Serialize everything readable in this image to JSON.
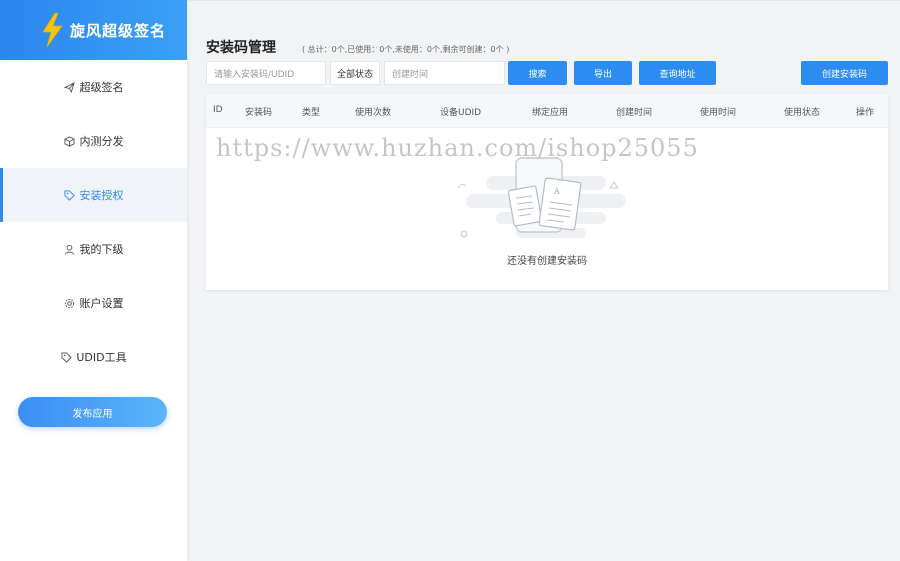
{
  "app": {
    "name": "旋风超级签名"
  },
  "sidebar": {
    "items": [
      {
        "label": "超级签名",
        "icon": "send-icon"
      },
      {
        "label": "内测分发",
        "icon": "cube-icon"
      },
      {
        "label": "安装授权",
        "icon": "tag-icon",
        "active": true
      },
      {
        "label": "我的下级",
        "icon": "user-icon"
      },
      {
        "label": "账户设置",
        "icon": "gear-icon"
      },
      {
        "label": "UDID工具",
        "icon": "tag-icon"
      }
    ],
    "publish_label": "发布应用"
  },
  "page": {
    "title": "安装码管理",
    "stats": "( 总计：0个,已使用：0个,未使用：0个,剩余可创建：0个 )"
  },
  "filters": {
    "search_placeholder": "请输入安装码/UDID",
    "status_select": "全部状态",
    "date_placeholder": "创建时间",
    "search_btn": "搜索",
    "export_btn": "导出",
    "query_btn": "查询地址",
    "create_btn": "创建安装码"
  },
  "table": {
    "columns": [
      "ID",
      "安装码",
      "类型",
      "使用次数",
      "设备UDID",
      "绑定应用",
      "创建时间",
      "使用时间",
      "使用状态",
      "操作"
    ],
    "rows": [],
    "empty_text": "还没有创建安装码"
  },
  "watermark": "https://www.huzhan.com/ishop25055",
  "colors": {
    "accent": "#2d8cf0",
    "sidebar_active_bg": "#f0f3f7",
    "bolt": "#f5c518"
  }
}
